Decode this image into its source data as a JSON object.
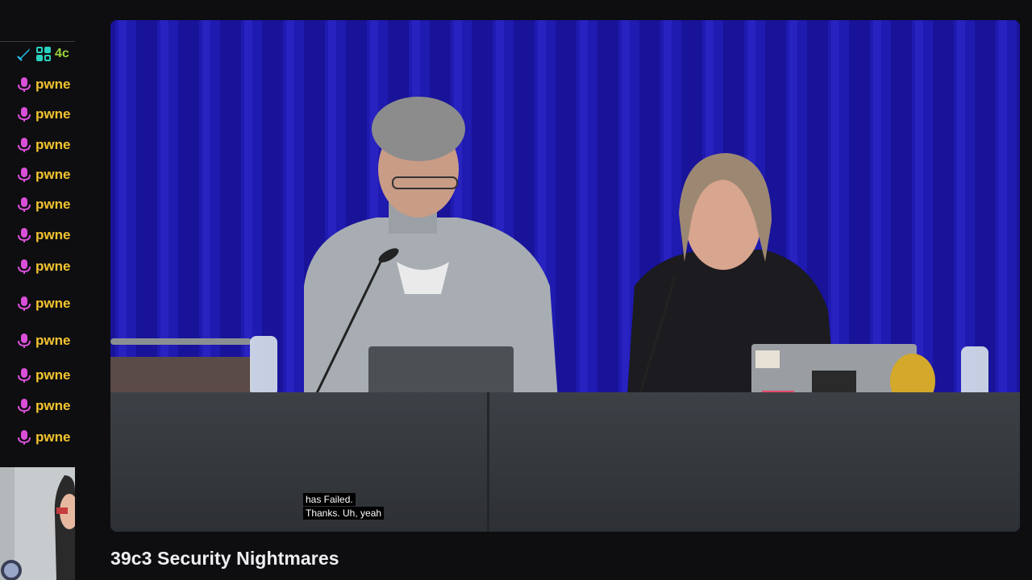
{
  "chat": {
    "badge_text": "4c",
    "entries": [
      {
        "name": "pwne"
      },
      {
        "name": "pwne"
      },
      {
        "name": "pwne"
      },
      {
        "name": "pwne"
      },
      {
        "name": "pwne"
      },
      {
        "name": "pwne"
      },
      {
        "name": "pwne"
      },
      {
        "name": "pwne"
      },
      {
        "name": "pwne"
      },
      {
        "name": "pwne"
      },
      {
        "name": "pwne"
      },
      {
        "name": "pwne"
      }
    ],
    "name_color": "#f4c430",
    "mic_color": "#d94fd8"
  },
  "video": {
    "captions": [
      "has  Failed.",
      "Thanks. Uh, yeah"
    ]
  },
  "stream": {
    "title": "39c3 Security Nightmares"
  }
}
